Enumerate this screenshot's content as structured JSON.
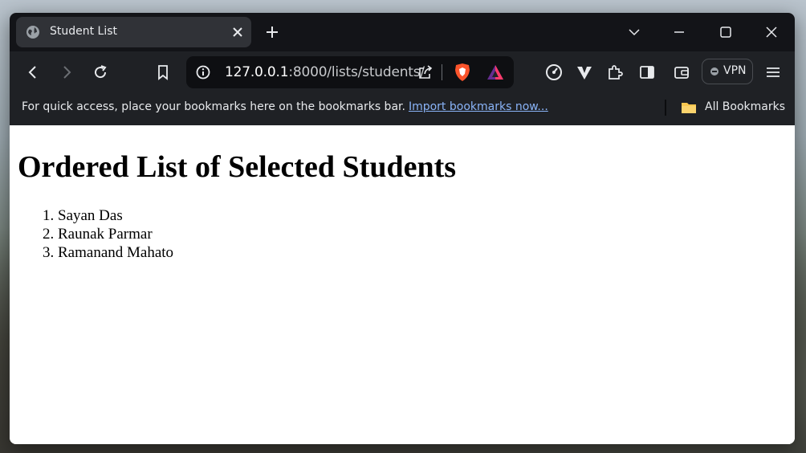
{
  "tab": {
    "title": "Student List"
  },
  "omnibox": {
    "host": "127.0.0.1",
    "path": ":8000/lists/students/"
  },
  "vpn": {
    "label": "VPN"
  },
  "bookmarks_bar": {
    "message": "For quick access, place your bookmarks here on the bookmarks bar.",
    "import_link": "Import bookmarks now...",
    "all_bookmarks": "All Bookmarks"
  },
  "page": {
    "heading": "Ordered List of Selected Students",
    "students": [
      "Sayan Das",
      "Raunak Parmar",
      "Ramanand Mahato"
    ]
  },
  "colors": {
    "titlebar": "#131418",
    "toolbar": "#1f2125",
    "link": "#8ab4f8",
    "brave_orange": "#fb542b"
  }
}
